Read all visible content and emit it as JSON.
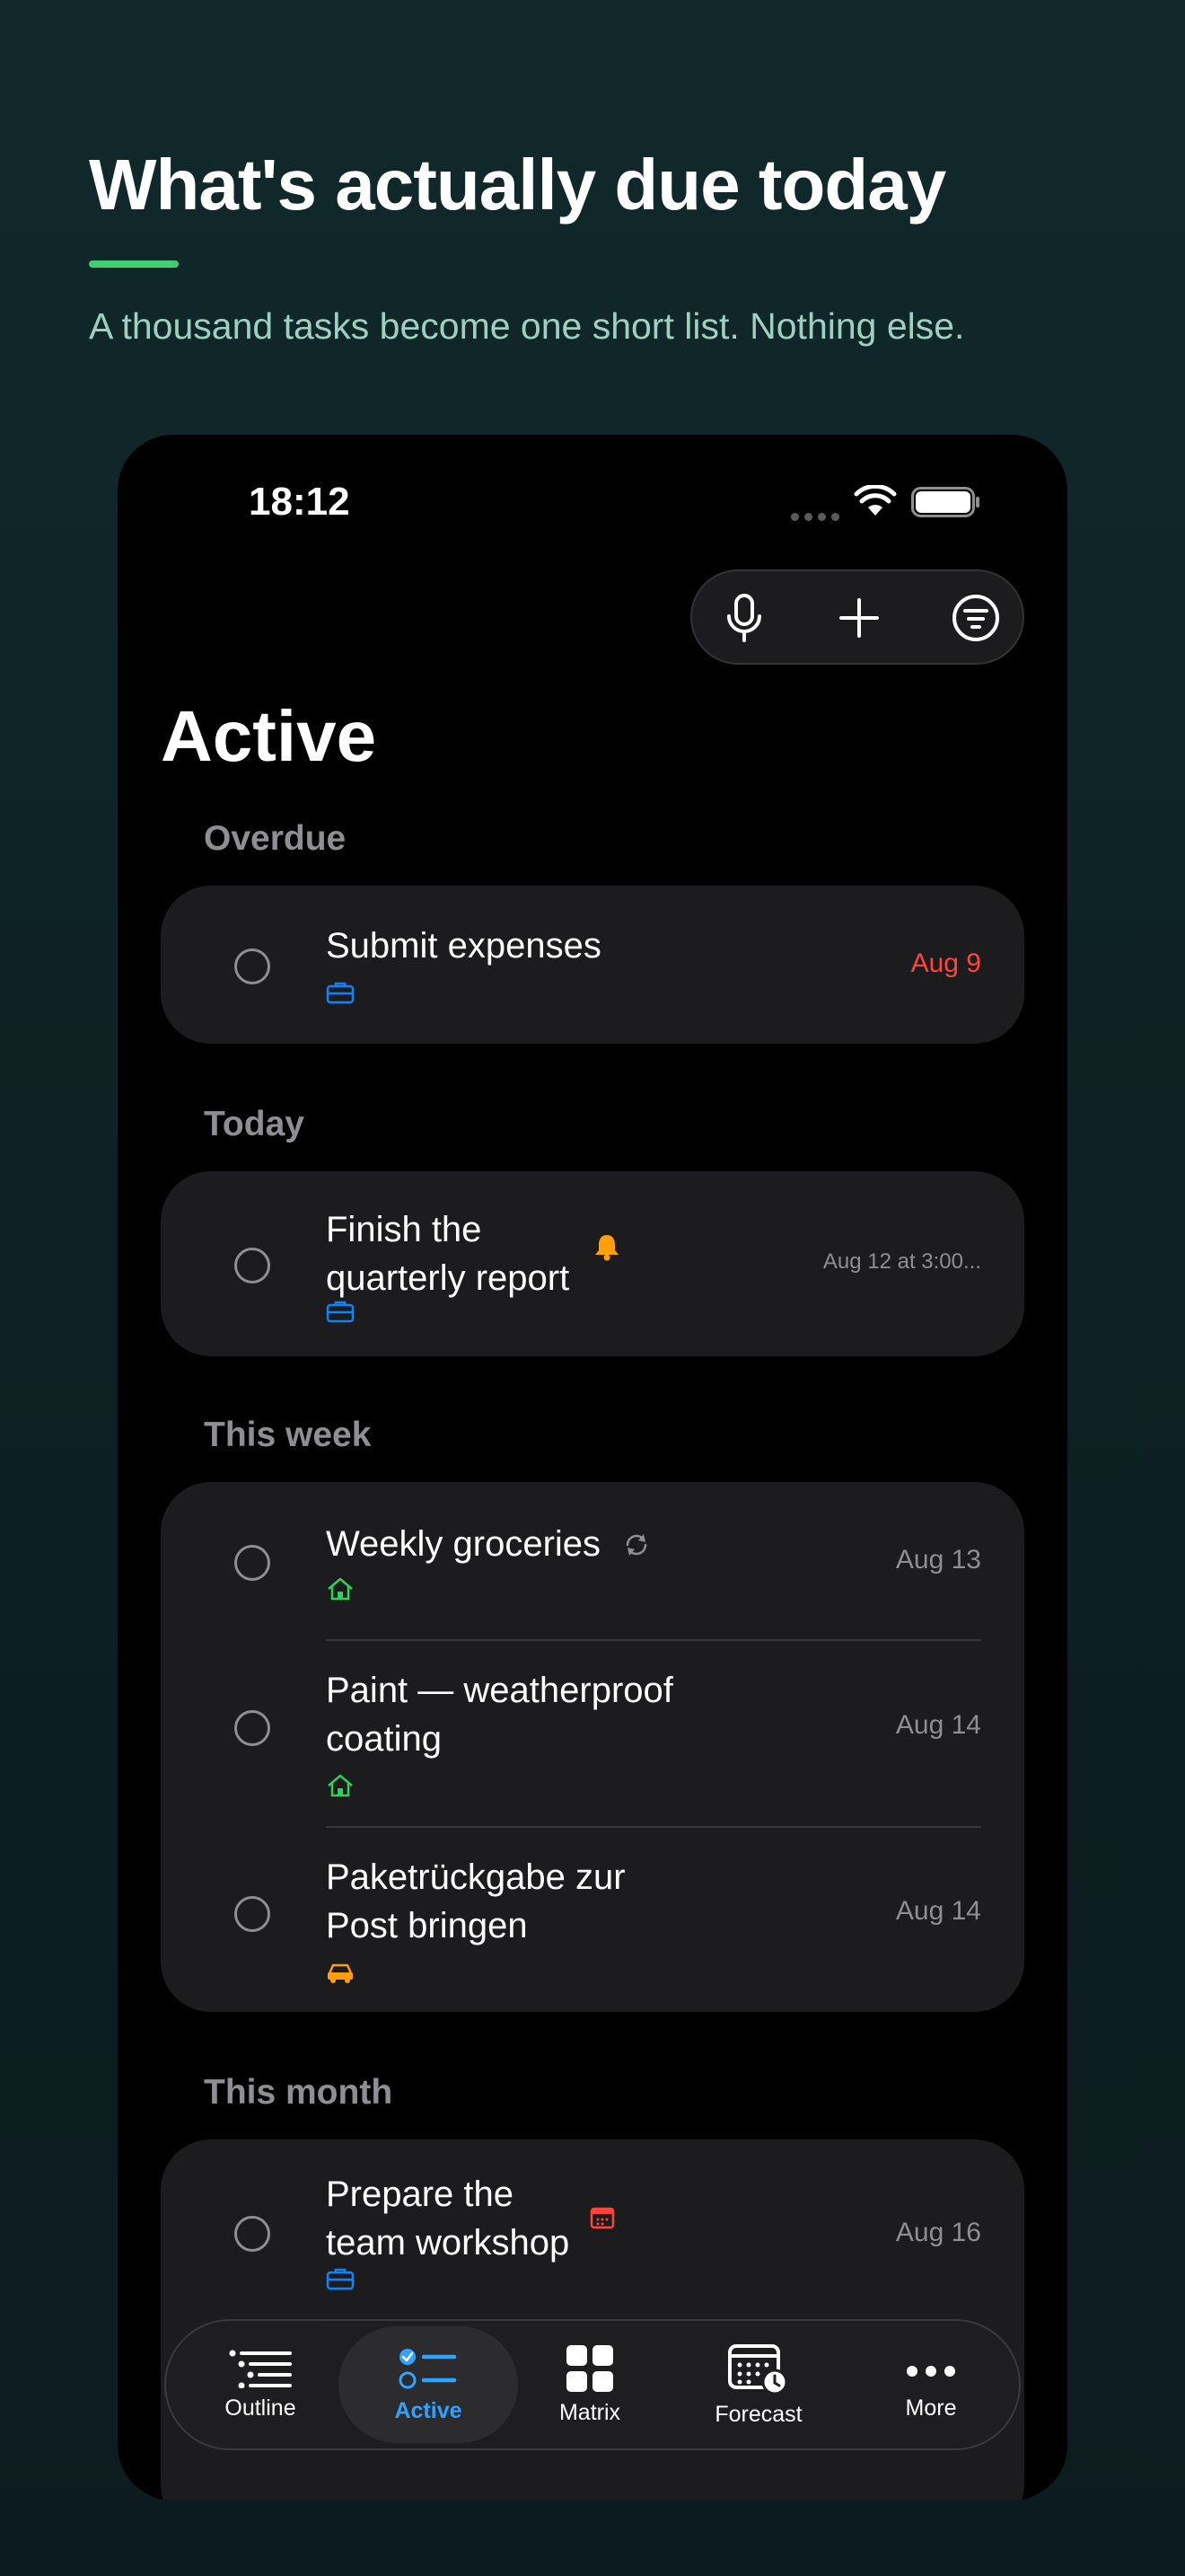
{
  "promo": {
    "headline": "What's actually due today",
    "subhead": "A thousand tasks become one short list. Nothing else."
  },
  "status_bar": {
    "time": "18:12"
  },
  "toolbar": {
    "icons": [
      "microphone-icon",
      "plus-icon",
      "filter-icon"
    ]
  },
  "page": {
    "title": "Active"
  },
  "sections": [
    {
      "header": "Overdue",
      "tasks": [
        {
          "title": "Submit expenses",
          "date": "Aug 9",
          "category_icon": "briefcase-icon"
        }
      ]
    },
    {
      "header": "Today",
      "tasks": [
        {
          "title_line1": "Finish the",
          "title_line2": "quarterly report",
          "date": "Aug 12 at 3:00...",
          "category_icon": "briefcase-icon",
          "badge_icon": "bell-icon"
        }
      ]
    },
    {
      "header": "This week",
      "tasks": [
        {
          "title": "Weekly groceries",
          "date": "Aug 13",
          "category_icon": "home-icon",
          "badge_icon": "repeat-icon"
        },
        {
          "title_line1": "Paint — weatherproof",
          "title_line2": "coating",
          "date": "Aug 14",
          "category_icon": "home-icon"
        },
        {
          "title_line1": "Paketrückgabe zur",
          "title_line2": "Post bringen",
          "date": "Aug 14",
          "category_icon": "car-icon"
        }
      ]
    },
    {
      "header": "This month",
      "tasks": [
        {
          "title_line1": "Prepare the",
          "title_line2": "team workshop",
          "date": "Aug 16",
          "category_icon": "briefcase-icon",
          "badge_icon": "calendar-icon"
        }
      ]
    }
  ],
  "tabs": [
    {
      "label": "Outline",
      "icon": "outline-list-icon"
    },
    {
      "label": "Active",
      "icon": "active-checklist-icon",
      "selected": true
    },
    {
      "label": "Matrix",
      "icon": "matrix-grid-icon"
    },
    {
      "label": "Forecast",
      "icon": "forecast-calendar-icon"
    },
    {
      "label": "More",
      "icon": "more-dots-icon"
    }
  ],
  "colors": {
    "accent_green": "#3ecf72",
    "overdue_red": "#ff453a",
    "active_tab_blue": "#30a2ff",
    "work_blue": "#0a84ff",
    "home_green": "#30d158",
    "errand_orange": "#ff9f0a"
  }
}
